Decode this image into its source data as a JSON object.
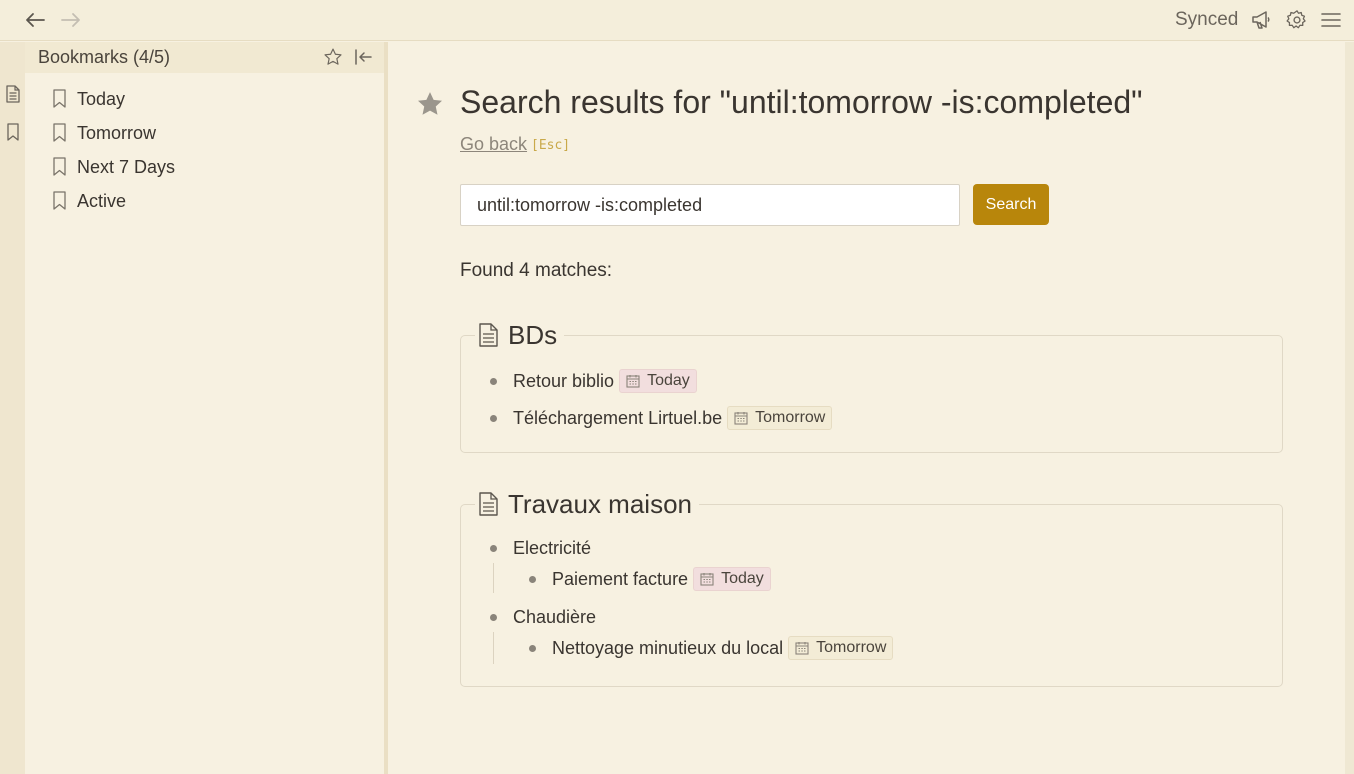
{
  "topbar": {
    "back_icon": "arrow-left-icon",
    "forward_icon": "arrow-right-icon",
    "status": "Synced",
    "icons": [
      "megaphone-icon",
      "gear-icon",
      "hamburger-menu-icon"
    ]
  },
  "rail": {
    "icons": [
      "document-icon",
      "bookmark-icon"
    ]
  },
  "sidebar": {
    "title": "Bookmarks (4/5)",
    "items": [
      {
        "label": "Today"
      },
      {
        "label": "Tomorrow"
      },
      {
        "label": "Next 7 Days"
      },
      {
        "label": "Active"
      }
    ]
  },
  "main": {
    "title": "Search results for \"until:tomorrow -is:completed\"",
    "go_back": "Go back",
    "esc_hint": "[Esc]",
    "search_value": "until:tomorrow -is:completed",
    "search_button": "Search",
    "found": "Found 4 matches:",
    "results": [
      {
        "title": "BDs",
        "items": [
          {
            "text": "Retour biblio",
            "due": "Today"
          },
          {
            "text": "Téléchargement Lirtuel.be",
            "due": "Tomorrow"
          }
        ]
      },
      {
        "title": "Travaux maison",
        "groups": [
          {
            "text": "Electricité",
            "children": [
              {
                "text": "Paiement facture",
                "due": "Today"
              }
            ]
          },
          {
            "text": "Chaudière",
            "children": [
              {
                "text": "Nettoyage minutieux du local",
                "due": "Tomorrow"
              }
            ]
          }
        ]
      }
    ]
  },
  "colors": {
    "accent": "#b8860b",
    "background": "#f7f1e1",
    "badge_today": "#f2dede",
    "badge_tomorrow": "#f3ecd6"
  }
}
